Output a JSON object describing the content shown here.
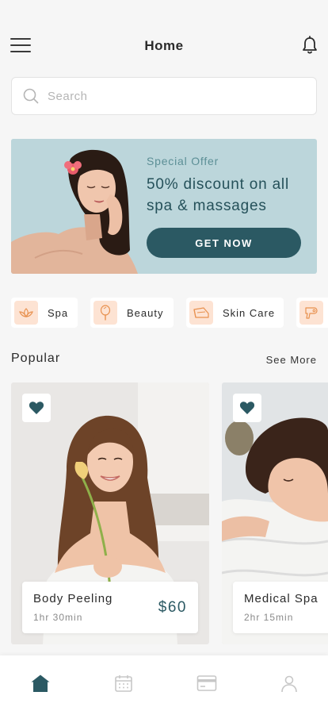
{
  "header": {
    "title": "Home",
    "menu_icon": "hamburger-menu-icon",
    "notification_icon": "bell-icon"
  },
  "search": {
    "placeholder": "Search",
    "value": "",
    "icon": "search-icon"
  },
  "banner": {
    "tag": "Special Offer",
    "text": "50% discount on all spa & massages",
    "button_label": "GET NOW"
  },
  "categories": [
    {
      "label": "Spa",
      "icon": "lotus-icon"
    },
    {
      "label": "Beauty",
      "icon": "mirror-icon"
    },
    {
      "label": "Skin Care",
      "icon": "cream-tube-icon"
    },
    {
      "label": "",
      "icon": "hair-dryer-icon"
    }
  ],
  "popular": {
    "title": "Popular",
    "see_more": "See More",
    "items": [
      {
        "name": "Body Peeling",
        "duration": "1hr 30min",
        "price": "$60",
        "favorite": true
      },
      {
        "name": "Medical Spa",
        "duration": "2hr 15min",
        "price": "",
        "favorite": true
      }
    ]
  },
  "tabbar": {
    "active": "home",
    "items": [
      "home-icon",
      "calendar-icon",
      "payment-card-icon",
      "profile-icon"
    ]
  },
  "colors": {
    "accent": "#2b5963",
    "banner_bg": "#bcd6db",
    "category_icon_bg": "#fde3d3",
    "category_icon_fg": "#e8914f",
    "background": "#f6f6f6"
  }
}
